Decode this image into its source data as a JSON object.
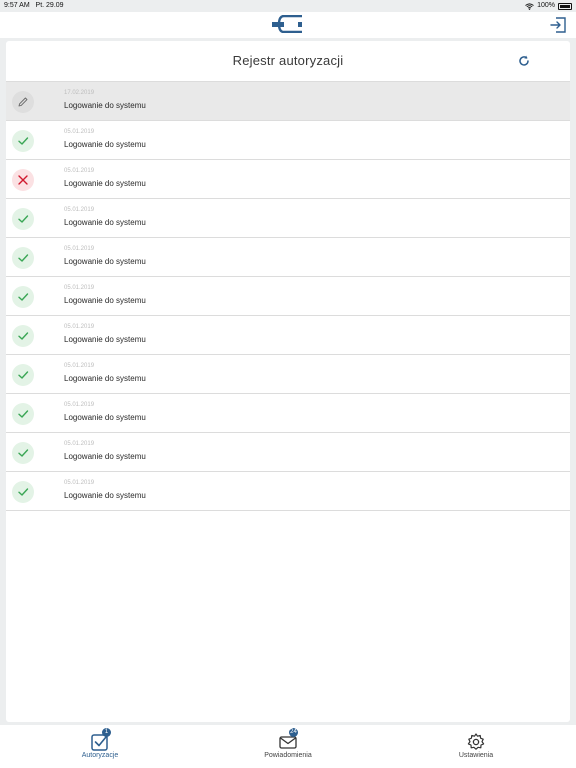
{
  "status_bar": {
    "time": "9:57 AM",
    "date": "Pt. 29.09",
    "battery": "100%"
  },
  "header": {
    "logo_icon": "bank-logo-icon",
    "logout_icon": "logout-icon"
  },
  "card": {
    "title": "Rejestr autoryzacji",
    "refresh_icon": "refresh-icon",
    "rows": [
      {
        "date": "17.02.2019",
        "text": "Logowanie do systemu",
        "status": "edit"
      },
      {
        "date": "05.01.2019",
        "text": "Logowanie do systemu",
        "status": "ok"
      },
      {
        "date": "05.01.2019",
        "text": "Logowanie do systemu",
        "status": "fail"
      },
      {
        "date": "05.01.2019",
        "text": "Logowanie do systemu",
        "status": "ok"
      },
      {
        "date": "05.01.2019",
        "text": "Logowanie do systemu",
        "status": "ok"
      },
      {
        "date": "05.01.2019",
        "text": "Logowanie do systemu",
        "status": "ok"
      },
      {
        "date": "05.01.2019",
        "text": "Logowanie do systemu",
        "status": "ok"
      },
      {
        "date": "05.01.2019",
        "text": "Logowanie do systemu",
        "status": "ok"
      },
      {
        "date": "05.01.2019",
        "text": "Logowanie do systemu",
        "status": "ok"
      },
      {
        "date": "05.01.2019",
        "text": "Logowanie do systemu",
        "status": "ok"
      },
      {
        "date": "05.01.2019",
        "text": "Logowanie do systemu",
        "status": "ok"
      }
    ]
  },
  "tabs": [
    {
      "label": "Autoryzacje",
      "badge": "1",
      "icon": "checkbox-icon",
      "active": true
    },
    {
      "label": "Powiadomienia",
      "badge": "24",
      "icon": "envelope-icon",
      "active": false
    },
    {
      "label": "Ustawienia",
      "badge": "",
      "icon": "gear-icon",
      "active": false
    }
  ],
  "colors": {
    "accent": "#2e5f8f",
    "success": "#3aa655",
    "success_bg": "#e3f3e6",
    "error": "#d0192e",
    "error_bg": "#fbe1e3",
    "background": "#eceeef"
  }
}
